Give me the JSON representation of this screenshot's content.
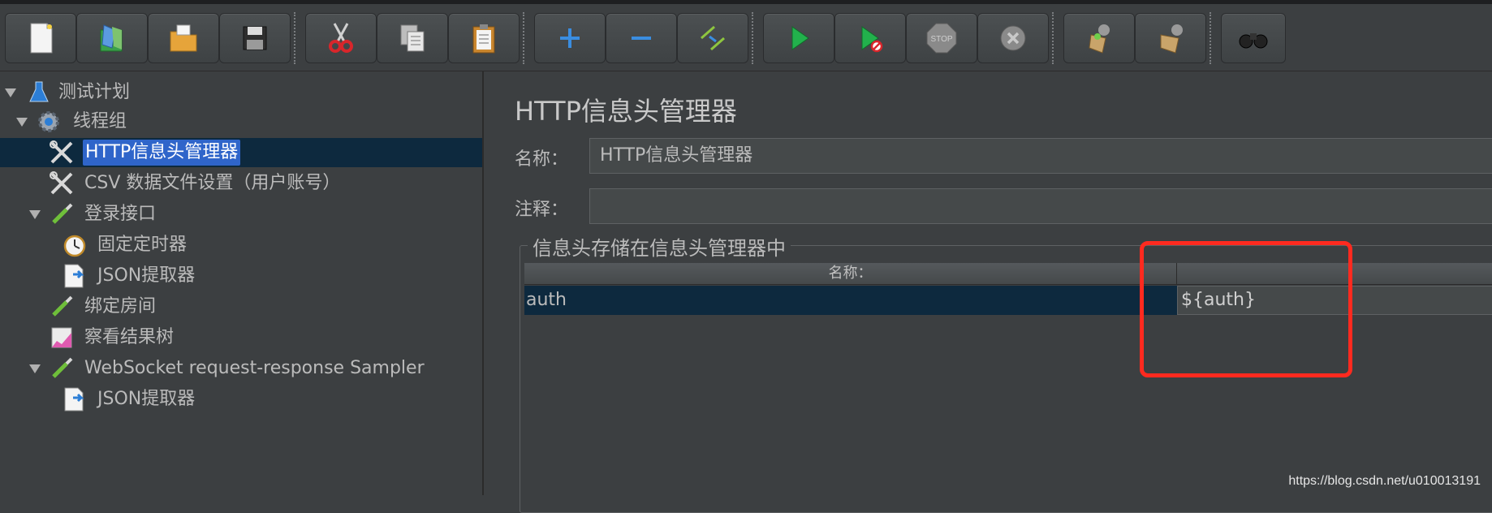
{
  "toolbar": {
    "buttons": [
      {
        "icon": "new-file-icon"
      },
      {
        "icon": "templates-icon"
      },
      {
        "icon": "open-folder-icon"
      },
      {
        "icon": "save-icon"
      },
      {
        "icon": "cut-icon"
      },
      {
        "icon": "copy-icon"
      },
      {
        "icon": "paste-icon"
      },
      {
        "icon": "expand-plus-icon"
      },
      {
        "icon": "collapse-minus-icon"
      },
      {
        "icon": "toggle-icon"
      },
      {
        "icon": "start-icon"
      },
      {
        "icon": "start-no-pauses-icon"
      },
      {
        "icon": "stop-icon"
      },
      {
        "icon": "shutdown-icon"
      },
      {
        "icon": "clear-icon"
      },
      {
        "icon": "clear-all-icon"
      },
      {
        "icon": "search-binoculars-icon"
      }
    ],
    "stop_text": "STOP"
  },
  "tree": {
    "items": [
      {
        "label": "测试计划",
        "icon": "flask-icon",
        "expanded": true
      },
      {
        "label": "线程组",
        "icon": "gear-icon",
        "expanded": true
      },
      {
        "label": "HTTP信息头管理器",
        "icon": "wrench-icon",
        "selected": true
      },
      {
        "label": "CSV 数据文件设置（用户账号）",
        "icon": "wrench-icon"
      },
      {
        "label": "登录接口",
        "icon": "pipette-icon",
        "expanded": true
      },
      {
        "label": "固定定时器",
        "icon": "timer-icon"
      },
      {
        "label": "JSON提取器",
        "icon": "extractor-icon"
      },
      {
        "label": "绑定房间",
        "icon": "pipette-icon"
      },
      {
        "label": "察看结果树",
        "icon": "graph-icon"
      },
      {
        "label": "WebSocket request-response Sampler",
        "icon": "pipette-icon",
        "expanded": true
      },
      {
        "label": "JSON提取器",
        "icon": "extractor-icon"
      }
    ]
  },
  "panel": {
    "title": "HTTP信息头管理器",
    "name_label": "名称：",
    "name_value": "HTTP信息头管理器",
    "comment_label": "注释：",
    "comment_value": "",
    "group_title": "信息头存储在信息头管理器中",
    "table": {
      "headers": {
        "name": "名称：",
        "value": ""
      },
      "rows": [
        {
          "name": "auth",
          "value": "${auth}"
        }
      ]
    }
  },
  "watermark": "https://blog.csdn.net/u010013191",
  "colors": {
    "background": "#3c3f41",
    "selection": "#2f65ca",
    "row_selection": "#0d293e",
    "highlight": "#ff2a1f"
  }
}
